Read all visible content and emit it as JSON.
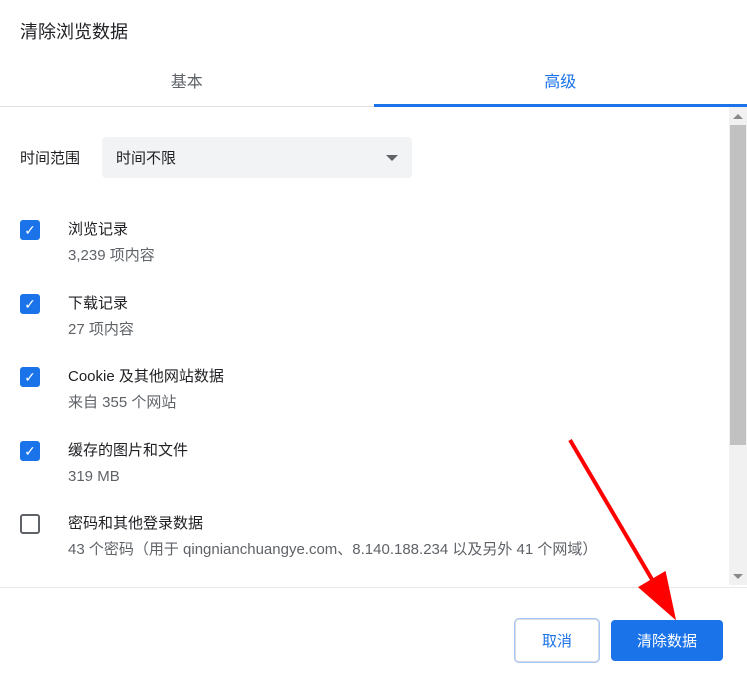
{
  "dialog": {
    "title": "清除浏览数据"
  },
  "tabs": {
    "basic": "基本",
    "advanced": "高级"
  },
  "time_range": {
    "label": "时间范围",
    "selected": "时间不限"
  },
  "options": [
    {
      "checked": true,
      "title": "浏览记录",
      "subtitle": "3,239 项内容"
    },
    {
      "checked": true,
      "title": "下载记录",
      "subtitle": "27 项内容"
    },
    {
      "checked": true,
      "title": "Cookie 及其他网站数据",
      "subtitle": "来自 355 个网站"
    },
    {
      "checked": true,
      "title": "缓存的图片和文件",
      "subtitle": "319 MB"
    },
    {
      "checked": false,
      "title": "密码和其他登录数据",
      "subtitle": "43 个密码（用于 qingnianchuangye.com、8.140.188.234 以及另外 41 个网域）"
    }
  ],
  "footer": {
    "cancel": "取消",
    "confirm": "清除数据"
  }
}
